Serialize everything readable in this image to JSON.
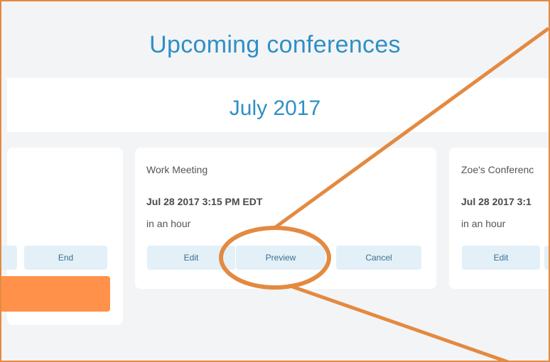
{
  "header": {
    "title": "Upcoming conferences"
  },
  "month": {
    "label": "July 2017"
  },
  "cards": [
    {
      "title": "",
      "date": "",
      "relative": "",
      "buttons": [
        "End"
      ]
    },
    {
      "title": "Work Meeting",
      "date": "Jul 28 2017 3:15 PM EDT",
      "relative": "in an hour",
      "buttons": [
        "Edit",
        "Preview",
        "Cancel"
      ]
    },
    {
      "title": "Zoe's Conferenc",
      "date": "Jul 28 2017 3:1",
      "relative": "in an hour",
      "buttons": [
        "Edit"
      ]
    }
  ],
  "colors": {
    "accent": "#2f8fc6",
    "annotation": "#e38a41",
    "primary_button": "#ff914a",
    "button_bg": "#e3f0f8"
  }
}
